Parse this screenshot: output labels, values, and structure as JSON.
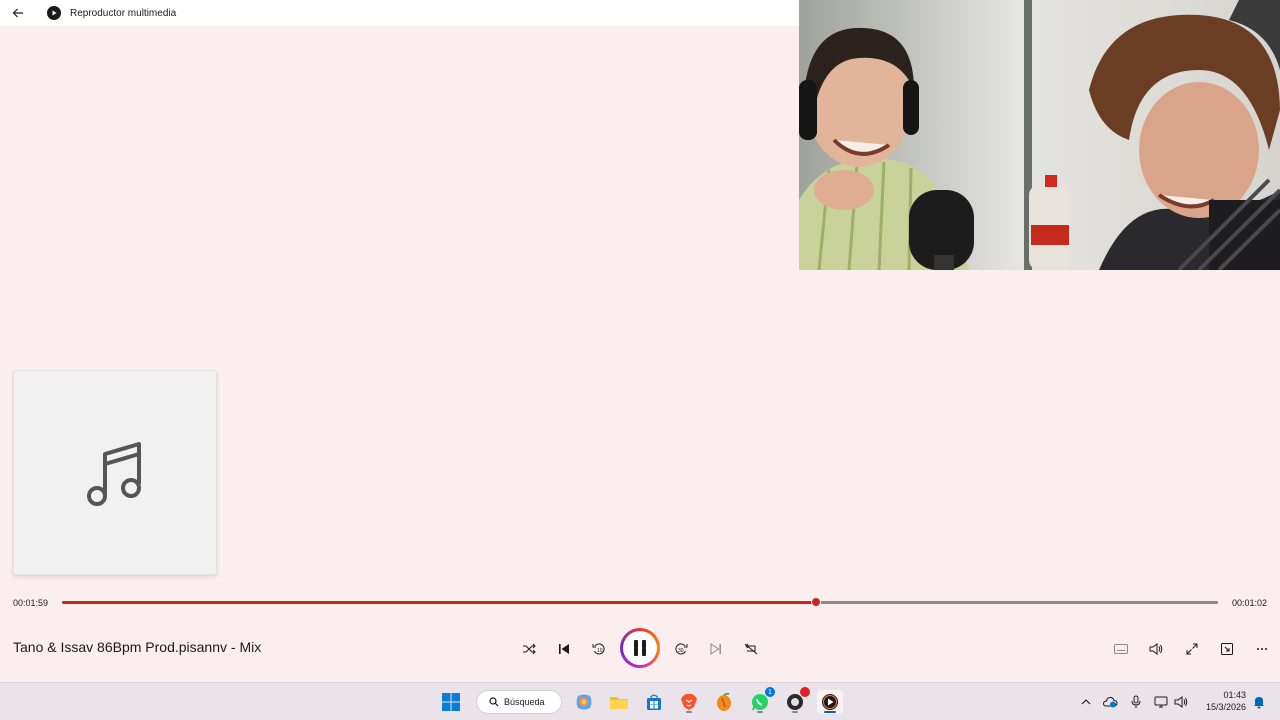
{
  "window": {
    "title": "Reproductor multimedia"
  },
  "player": {
    "elapsed": "00:01:59",
    "remaining": "00:01:02",
    "progress_fraction": 0.6523,
    "track_title": "Tano & Issav 86Bpm Prod.pisannv - Mix",
    "state": "playing"
  },
  "colors": {
    "accent": "#c42b1c",
    "background": "#fbeeee",
    "track_base": "#8a8a8a"
  },
  "icons": {
    "back": "arrow-left-icon",
    "art": "music-note-icon",
    "shuffle": "shuffle-icon",
    "previous": "previous-icon",
    "rewind": "rewind-10-icon",
    "pause": "pause-icon",
    "forward": "forward-30-icon",
    "next": "next-icon",
    "repeat": "repeat-off-icon",
    "captions": "captions-icon",
    "volume": "volume-icon",
    "fullscreen": "fullscreen-icon",
    "miniplayer": "miniplayer-icon",
    "more": "more-icon"
  },
  "taskbar": {
    "search_label": "Búsqueda",
    "whatsapp_badge": "1",
    "clock_time": "01:43",
    "clock_date": "15/3/2026"
  }
}
